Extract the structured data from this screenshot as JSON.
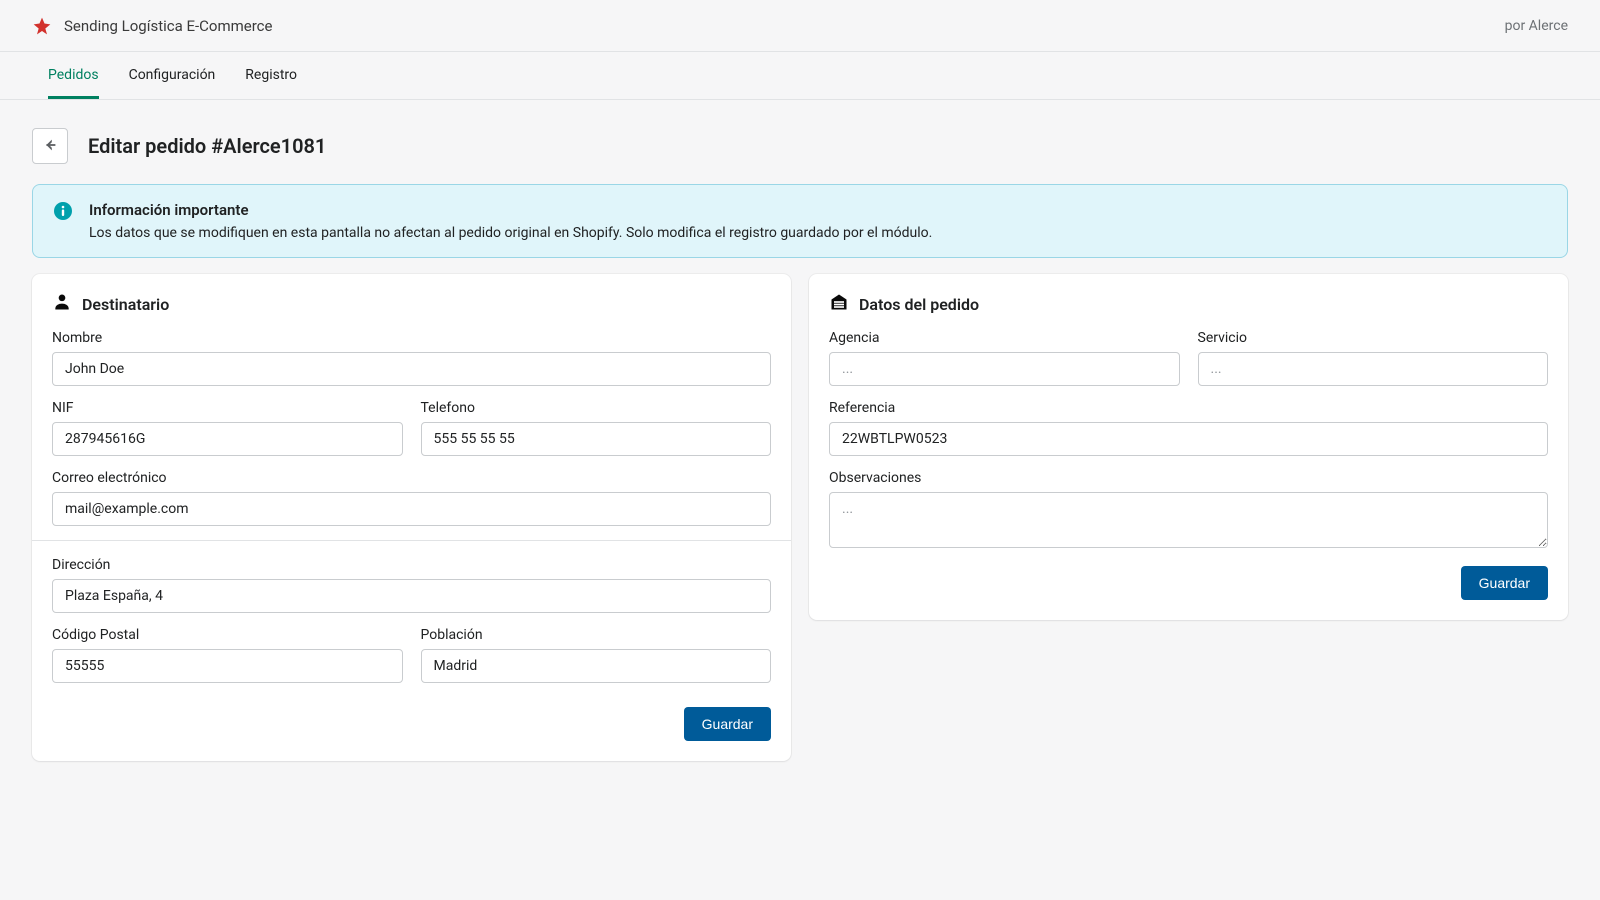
{
  "header": {
    "app_title": "Sending Logística E-Commerce",
    "by_text": "por Alerce"
  },
  "tabs": {
    "orders": "Pedidos",
    "config": "Configuración",
    "log": "Registro"
  },
  "page": {
    "title": "Editar pedido #Alerce1081"
  },
  "banner": {
    "title": "Información importante",
    "text": "Los datos que se modifiquen en esta pantalla no afectan al pedido original en Shopify. Solo modifica el registro guardado por el módulo."
  },
  "recipient": {
    "section_title": "Destinatario",
    "name_label": "Nombre",
    "name_value": "John Doe",
    "nif_label": "NIF",
    "nif_value": "287945616G",
    "phone_label": "Telefono",
    "phone_value": "555 55 55 55",
    "email_label": "Correo electrónico",
    "email_value": "mail@example.com",
    "address_label": "Dirección",
    "address_value": "Plaza España, 4",
    "zip_label": "Código Postal",
    "zip_value": "55555",
    "city_label": "Población",
    "city_value": "Madrid",
    "save_label": "Guardar"
  },
  "order": {
    "section_title": "Datos del pedido",
    "agency_label": "Agencia",
    "agency_placeholder": "...",
    "service_label": "Servicio",
    "service_placeholder": "...",
    "reference_label": "Referencia",
    "reference_value": "22WBTLPW0523",
    "notes_label": "Observaciones",
    "notes_placeholder": "...",
    "save_label": "Guardar"
  }
}
